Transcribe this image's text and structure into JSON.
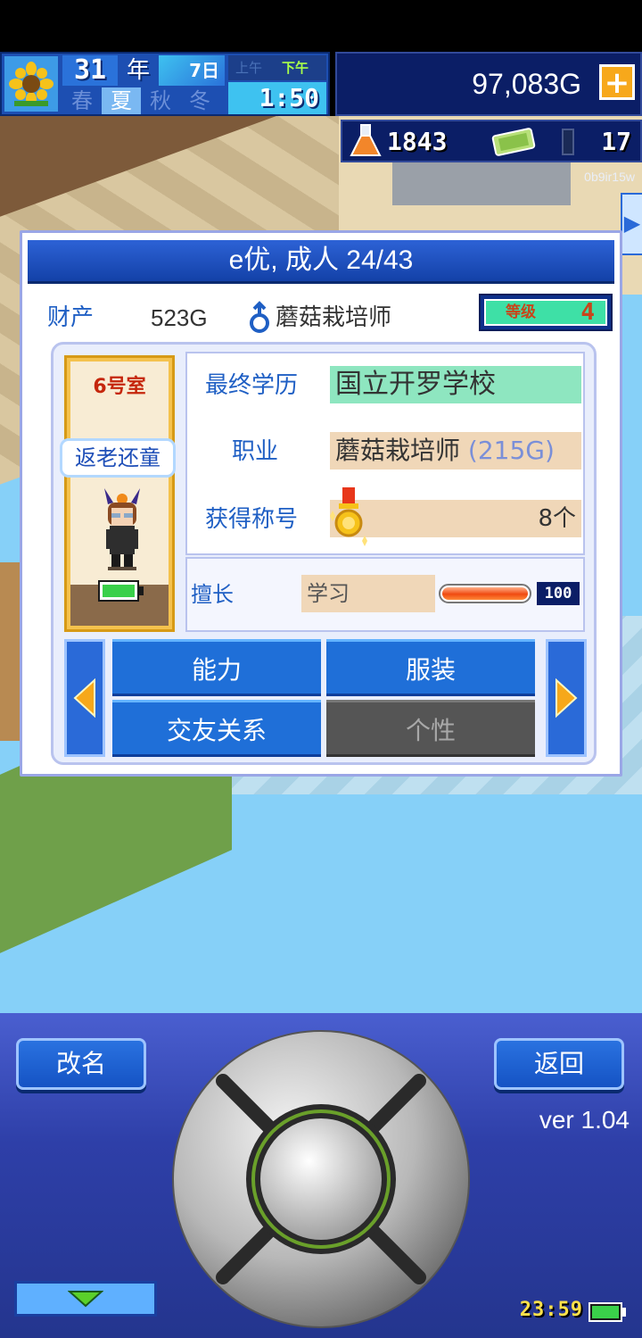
{
  "hud": {
    "year": "31",
    "year_unit": "年",
    "month": "7日",
    "seasons": [
      "春",
      "夏",
      "秋",
      "冬"
    ],
    "active_season": "夏",
    "am_label": "上午",
    "pm_label": "下午",
    "time": "1:50",
    "money": "97,083G",
    "add_money_symbol": "+",
    "research_points": "1843",
    "tickets": "17",
    "watermark": "0b9ir15w",
    "sunflower_icon": "sunflower-icon",
    "flask_icon": "flask-icon",
    "ticket_icon": "ticket-icon"
  },
  "panel": {
    "title": "e优, 成人 24/43",
    "asset_label": "财产",
    "asset_value": "523G",
    "gender_icon": "male-icon",
    "job": "蘑菇栽培师",
    "level_label": "等级",
    "level_value": "4",
    "room": "6号室",
    "trait": "返老还童",
    "education_label": "最终学历",
    "education_value": "国立开罗学校",
    "job_label": "职业",
    "job_value": "蘑菇栽培师",
    "job_salary": "(215G)",
    "titles_label": "获得称号",
    "titles_value": "8个",
    "skill_label": "擅长",
    "skill_value": "学习",
    "skill_level": 1.0,
    "skill_number": "100",
    "tabs": {
      "ability": "能力",
      "costume": "服装",
      "friends": "交友关系",
      "personality": "个性"
    }
  },
  "controls": {
    "rename": "改名",
    "back": "返回",
    "version": "ver 1.04",
    "system_time": "23:59"
  },
  "colors": {
    "accent": "#1f6fd8",
    "money_plus": "#f7a81b",
    "education_bg": "#8ee6c0",
    "field_bg": "#f0d7b8",
    "room_name": "#c5260c"
  }
}
